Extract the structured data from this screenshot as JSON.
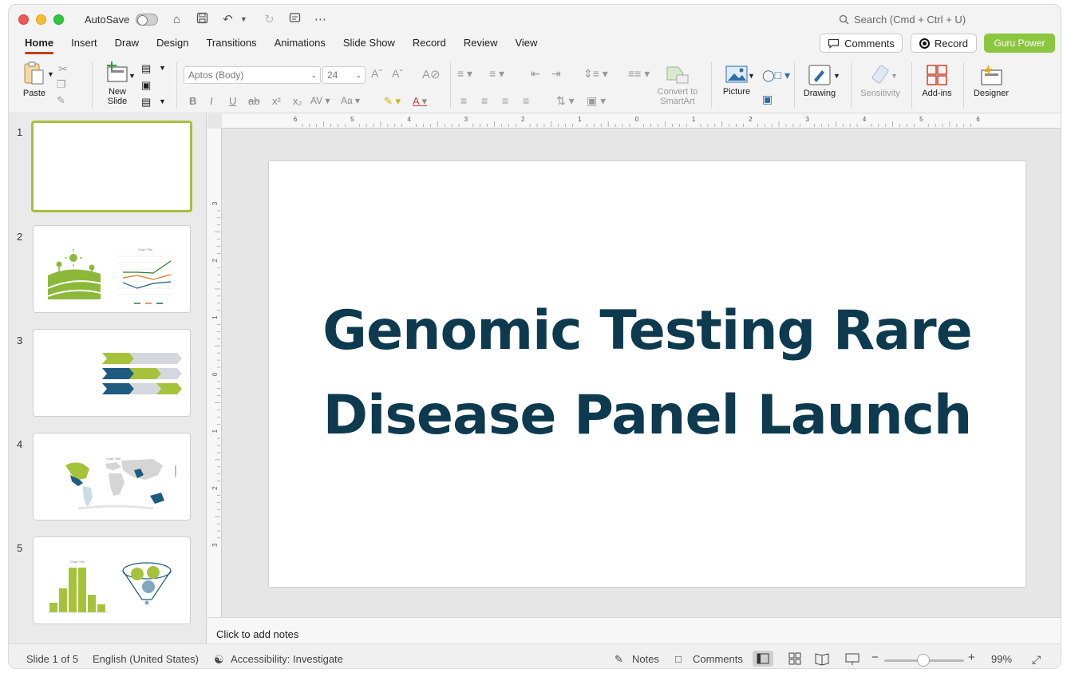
{
  "titlebar": {
    "autosave_label": "AutoSave",
    "search_placeholder": "Search (Cmd + Ctrl + U)"
  },
  "tabs": [
    "Home",
    "Insert",
    "Draw",
    "Design",
    "Transitions",
    "Animations",
    "Slide Show",
    "Record",
    "Review",
    "View"
  ],
  "header_buttons": {
    "comments": "Comments",
    "record": "Record",
    "guru": "Guru Power"
  },
  "ribbon": {
    "paste": "Paste",
    "new_slide_1": "New",
    "new_slide_2": "Slide",
    "font_name": "Aptos (Body)",
    "font_size": "24",
    "convert_1": "Convert to",
    "convert_2": "SmartArt",
    "picture": "Picture",
    "drawing": "Drawing",
    "sensitivity": "Sensitivity",
    "addins": "Add-ins",
    "designer": "Designer"
  },
  "ruler": {
    "h_ticks": [
      "6",
      "5",
      "4",
      "3",
      "2",
      "1",
      "0",
      "1",
      "2",
      "3",
      "4",
      "5",
      "6"
    ],
    "v_ticks": [
      "3",
      "2",
      "1",
      "0",
      "1",
      "2",
      "3"
    ]
  },
  "slides": [
    {
      "number": "1"
    },
    {
      "number": "2",
      "thumb_chart_title": "Chart Title"
    },
    {
      "number": "3"
    },
    {
      "number": "4",
      "thumb_chart_title": "Chart Title"
    },
    {
      "number": "5",
      "thumb_chart_title": "Chart Title"
    }
  ],
  "slide": {
    "title_line1": "Genomic Testing Rare",
    "title_line2": "Disease Panel Launch"
  },
  "notes_placeholder": "Click to add notes",
  "status": {
    "slide_count": "Slide 1 of 5",
    "language": "English (United States)",
    "accessibility": "Accessibility: Investigate",
    "notes": "Notes",
    "comments": "Comments",
    "zoom": "99%"
  },
  "colors": {
    "title_text": "#0d3a4f",
    "accent_green": "#8cc63f",
    "active_tab": "#c43e1c",
    "navy": "#1e5b80"
  }
}
